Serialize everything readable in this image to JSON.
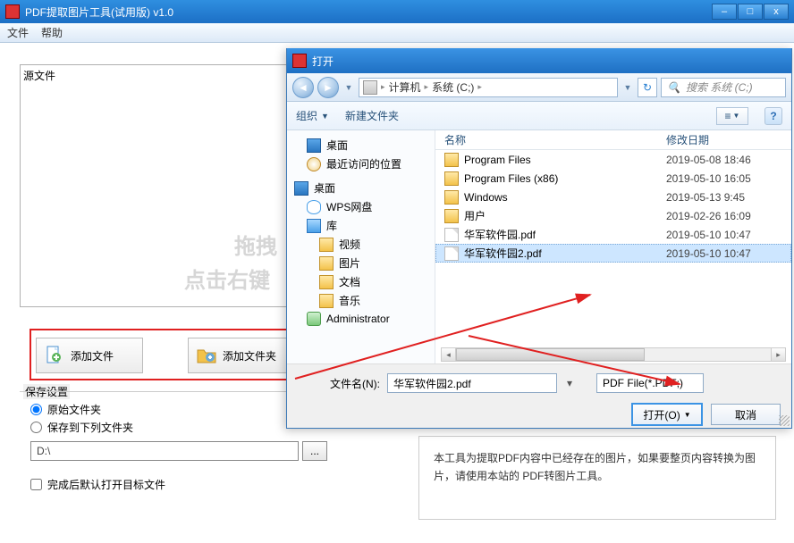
{
  "main": {
    "title": "PDF提取图片工具(试用版) v1.0",
    "menu": {
      "file": "文件",
      "help": "帮助"
    },
    "source_label": "源文件",
    "watermark1": "拖拽",
    "watermark2": "点击右键",
    "add_file": "添加文件",
    "add_folder": "添加文件夹",
    "save_group": "保存设置",
    "radio_original": "原始文件夹",
    "radio_custom": "保存到下列文件夹",
    "path_value": "D:\\",
    "browse": "...",
    "open_after": "完成后默认打开目标文件",
    "info": "本工具为提取PDF内容中已经存在的图片，如果要整页内容转换为图片，请使用本站的 PDF转图片工具。"
  },
  "dialog": {
    "title": "打开",
    "crumbs": {
      "computer": "计算机",
      "drive": "系统 (C;)"
    },
    "search_placeholder": "搜索 系统 (C;)",
    "toolbar": {
      "organize": "组织",
      "newfolder": "新建文件夹"
    },
    "columns": {
      "name": "名称",
      "date": "修改日期"
    },
    "tree": [
      {
        "lvl": 1,
        "icon": "monitor",
        "label": "桌面"
      },
      {
        "lvl": 1,
        "icon": "clock",
        "label": "最近访问的位置"
      },
      {
        "lvl": 0,
        "icon": "monitor",
        "label": "桌面"
      },
      {
        "lvl": 1,
        "icon": "cloud",
        "label": "WPS网盘"
      },
      {
        "lvl": 1,
        "icon": "lib",
        "label": "库"
      },
      {
        "lvl": 2,
        "icon": "folder",
        "label": "视频"
      },
      {
        "lvl": 2,
        "icon": "folder",
        "label": "图片"
      },
      {
        "lvl": 2,
        "icon": "folder",
        "label": "文档"
      },
      {
        "lvl": 2,
        "icon": "folder",
        "label": "音乐"
      },
      {
        "lvl": 1,
        "icon": "user",
        "label": "Administrator"
      }
    ],
    "files": [
      {
        "type": "folder",
        "name": "Program Files",
        "date": "2019-05-08 18:46"
      },
      {
        "type": "folder",
        "name": "Program Files (x86)",
        "date": "2019-05-10 16:05"
      },
      {
        "type": "folder",
        "name": "Windows",
        "date": "2019-05-13 9:45"
      },
      {
        "type": "folder",
        "name": "用户",
        "date": "2019-02-26 16:09"
      },
      {
        "type": "pdf",
        "name": "华军软件园.pdf",
        "date": "2019-05-10 10:47"
      },
      {
        "type": "pdf",
        "name": "华军软件园2.pdf",
        "date": "2019-05-10 10:47",
        "selected": true
      }
    ],
    "filename_label": "文件名(N):",
    "filename_value": "华军软件园2.pdf",
    "filetype": "PDF File(*.PDF;)",
    "open_btn": "打开(O)",
    "cancel_btn": "取消"
  }
}
